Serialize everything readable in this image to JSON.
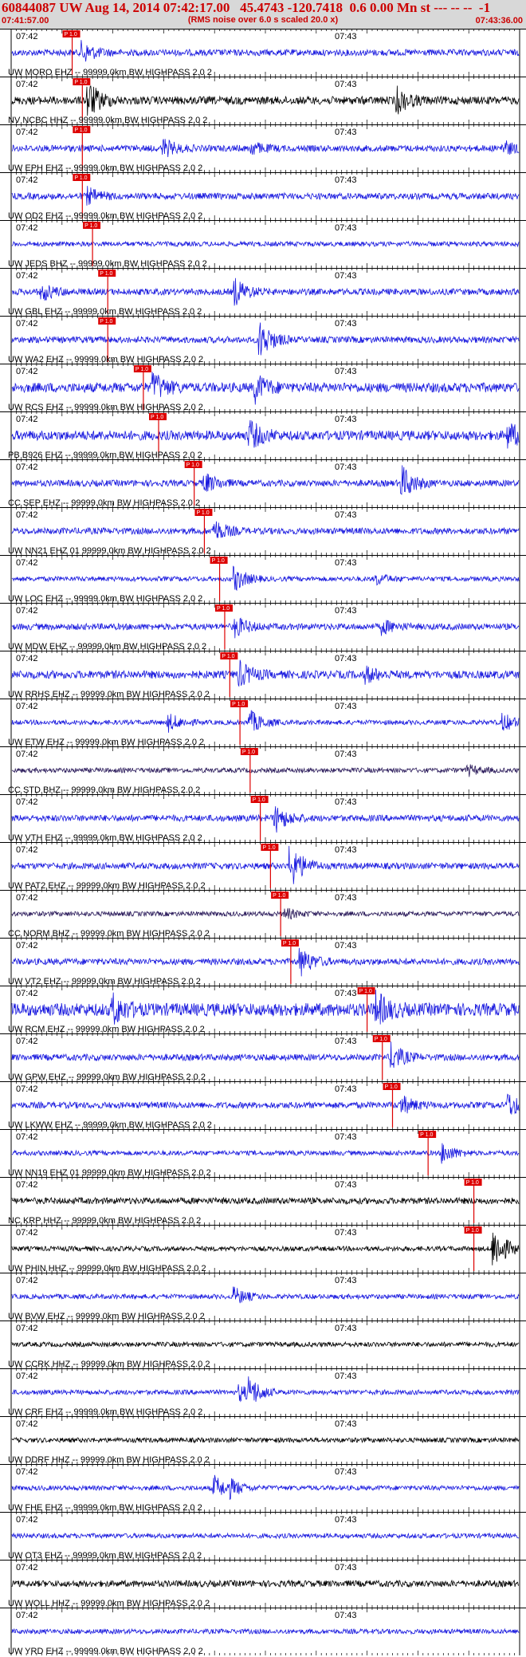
{
  "header": {
    "title": "60844087 UW Aug 14, 2014 07:42:17.00   45.4743 -120.7418  0.6 0.00 Mn st --- -- --  -1",
    "subtitle": "(RMS noise over 6.0 s scaled 20.0 x)",
    "start_time": "07:41:57.00",
    "end_time": "07:43:36.00"
  },
  "tick_labels": {
    "first": "07:42",
    "second": "07:43"
  },
  "pick_label": "P 1.0",
  "colors": {
    "header_bg": "#d8d8d8",
    "header_text": "#cc0000",
    "pick": "#dd0000",
    "trace_blue": "#1a1adf",
    "trace_black": "#000000",
    "trace_dark": "#2a1a5a"
  },
  "traces": [
    {
      "label": "UW MORO EHZ -- 99999.0km BW  HIGHPASS  2.0  2",
      "color": "blue",
      "pick": 0.12,
      "amp": 4,
      "events": [
        [
          0.14,
          12
        ]
      ]
    },
    {
      "label": "NV NCBC HHZ -- 99999.0km BW  HIGHPASS  2.0  2",
      "color": "black",
      "pick": 0.14,
      "amp": 5,
      "events": [
        [
          0.15,
          22
        ],
        [
          0.76,
          14
        ]
      ]
    },
    {
      "label": "UW EPH EHZ -- 99999.0km BW  HIGHPASS  2.0  2",
      "color": "blue",
      "pick": 0.14,
      "amp": 4,
      "events": [
        [
          0.3,
          10
        ],
        [
          0.47,
          8
        ],
        [
          0.97,
          8
        ]
      ]
    },
    {
      "label": "UW OD2 EHZ -- 99999.0km BW  HIGHPASS  2.0  2",
      "color": "blue",
      "pick": 0.14,
      "amp": 4,
      "events": [
        [
          0.15,
          9
        ]
      ]
    },
    {
      "label": "UW JEDS BHZ -- 99999.0km BW  HIGHPASS  2.0  2",
      "color": "blue",
      "pick": 0.16,
      "amp": 3,
      "events": []
    },
    {
      "label": "UW GBL EHZ -- 99999.0km BW  HIGHPASS  2.0  2",
      "color": "blue",
      "pick": 0.19,
      "amp": 4,
      "events": [
        [
          0.06,
          10
        ],
        [
          0.44,
          16
        ]
      ]
    },
    {
      "label": "UW WA2 EHZ -- 99999.0km BW  HIGHPASS  2.0  2",
      "color": "blue",
      "pick": 0.19,
      "amp": 4,
      "events": [
        [
          0.49,
          22
        ]
      ]
    },
    {
      "label": "UW RCS EHZ -- 99999.0km BW  HIGHPASS  2.0  2",
      "color": "blue",
      "pick": 0.26,
      "amp": 6,
      "events": [
        [
          0.28,
          16
        ],
        [
          0.48,
          16
        ]
      ]
    },
    {
      "label": "PB B926 EHZ -- 99999.0km BW  HIGHPASS  2.0  2",
      "color": "blue",
      "pick": 0.29,
      "amp": 6,
      "events": [
        [
          0.47,
          16
        ],
        [
          0.98,
          14
        ]
      ]
    },
    {
      "label": "CC SEP EHZ -- 99999.0km BW  HIGHPASS  2.0  2",
      "color": "blue",
      "pick": 0.36,
      "amp": 4,
      "events": [
        [
          0.38,
          12
        ],
        [
          0.77,
          20
        ]
      ]
    },
    {
      "label": "UW NN21 EHZ 01 99999.0km BW  HIGHPASS  2.0  2",
      "color": "blue",
      "pick": 0.38,
      "amp": 4,
      "events": [
        [
          0.4,
          12
        ]
      ]
    },
    {
      "label": "UW LOC EHZ -- 99999.0km BW  HIGHPASS  2.0  2",
      "color": "blue",
      "pick": 0.41,
      "amp": 3,
      "events": [
        [
          0.44,
          14
        ],
        [
          0.72,
          6
        ]
      ]
    },
    {
      "label": "UW MDW EHZ -- 99999.0km BW  HIGHPASS  2.0  2",
      "color": "blue",
      "pick": 0.42,
      "amp": 4,
      "events": [
        [
          0.44,
          12
        ],
        [
          0.73,
          8
        ]
      ]
    },
    {
      "label": "UW RRHS EHZ -- 99999.0km BW  HIGHPASS  2.0  2",
      "color": "blue",
      "pick": 0.43,
      "amp": 5,
      "events": [
        [
          0.45,
          14
        ],
        [
          0.7,
          8
        ]
      ]
    },
    {
      "label": "UW ETW EHZ -- 99999.0km BW  HIGHPASS  2.0  2",
      "color": "blue",
      "pick": 0.45,
      "amp": 3,
      "events": [
        [
          0.31,
          10
        ],
        [
          0.47,
          14
        ],
        [
          0.97,
          10
        ]
      ]
    },
    {
      "label": "CC STD BHZ -- 99999.0km BW  HIGHPASS  2.0  2",
      "color": "dark",
      "pick": 0.47,
      "amp": 3,
      "events": [
        [
          0.9,
          6
        ]
      ]
    },
    {
      "label": "UW VTH EHZ -- 99999.0km BW  HIGHPASS  2.0  2",
      "color": "blue",
      "pick": 0.49,
      "amp": 4,
      "events": [
        [
          0.52,
          16
        ]
      ]
    },
    {
      "label": "UW PAT2 EHZ -- 99999.0km BW  HIGHPASS  2.0  2",
      "color": "blue",
      "pick": 0.51,
      "amp": 4,
      "events": [
        [
          0.55,
          26
        ]
      ]
    },
    {
      "label": "CC NORM BHZ -- 99999.0km BW  HIGHPASS  2.0  2",
      "color": "dark",
      "pick": 0.53,
      "amp": 3,
      "events": [
        [
          0.54,
          6
        ]
      ]
    },
    {
      "label": "UW VT2 EHZ -- 99999.0km BW  HIGHPASS  2.0  2",
      "color": "blue",
      "pick": 0.55,
      "amp": 4,
      "events": [
        [
          0.57,
          16
        ]
      ]
    },
    {
      "label": "UW RCM EHZ -- 99999.0km BW  HIGHPASS  2.0  2",
      "color": "blue",
      "pick": 0.7,
      "amp": 8,
      "events": [
        [
          0.2,
          16
        ],
        [
          0.72,
          18
        ]
      ]
    },
    {
      "label": "UW GPW EHZ -- 99999.0km BW  HIGHPASS  2.0  2",
      "color": "blue",
      "pick": 0.73,
      "amp": 4,
      "events": [
        [
          0.75,
          16
        ]
      ]
    },
    {
      "label": "UW LKWW EHZ -- 99999.0km BW  HIGHPASS  2.0  2",
      "color": "blue",
      "pick": 0.75,
      "amp": 4,
      "events": [
        [
          0.77,
          10
        ],
        [
          0.98,
          14
        ]
      ]
    },
    {
      "label": "UW NN19 EHZ 01 99999.0km BW  HIGHPASS  2.0  2",
      "color": "blue",
      "pick": 0.82,
      "amp": 3,
      "events": [
        [
          0.85,
          12
        ]
      ]
    },
    {
      "label": "NC KRP HHZ -- 99999.0km BW  HIGHPASS  2.0  2",
      "color": "black",
      "pick": 0.91,
      "amp": 4,
      "events": []
    },
    {
      "label": "UW PHIN HHZ -- 99999.0km BW  HIGHPASS  2.0  2",
      "color": "black",
      "pick": 0.91,
      "amp": 3,
      "events": [
        [
          0.95,
          28
        ]
      ]
    },
    {
      "label": "UW BVW EHZ -- 99999.0km BW  HIGHPASS  2.0  2",
      "color": "blue",
      "pick": null,
      "amp": 3,
      "events": [
        [
          0.44,
          10
        ]
      ]
    },
    {
      "label": "UW CCRK HHZ -- 99999.0km BW  HIGHPASS  2.0  2",
      "color": "black",
      "pick": null,
      "amp": 3,
      "events": []
    },
    {
      "label": "UW CRF EHZ -- 99999.0km BW  HIGHPASS  2.0  2",
      "color": "blue",
      "pick": null,
      "amp": 3,
      "events": [
        [
          0.47,
          14
        ],
        [
          0.45,
          10
        ]
      ]
    },
    {
      "label": "UW DDRF HHZ -- 99999.0km BW  HIGHPASS  2.0  2",
      "color": "black",
      "pick": null,
      "amp": 3,
      "events": []
    },
    {
      "label": "UW FHE EHZ -- 99999.0km BW  HIGHPASS  2.0  2",
      "color": "blue",
      "pick": null,
      "amp": 3,
      "events": [
        [
          0.4,
          14
        ],
        [
          0.43,
          8
        ]
      ]
    },
    {
      "label": "UW OT3 EHZ -- 99999.0km BW  HIGHPASS  2.0  2",
      "color": "blue",
      "pick": null,
      "amp": 3,
      "events": []
    },
    {
      "label": "UW WOLL HHZ -- 99999.0km BW  HIGHPASS  2.0  2",
      "color": "black",
      "pick": null,
      "amp": 4,
      "events": []
    },
    {
      "label": "UW YRD EHZ -- 99999.0km BW  HIGHPASS  2.0  2",
      "color": "blue",
      "pick": null,
      "amp": 3,
      "events": []
    }
  ]
}
